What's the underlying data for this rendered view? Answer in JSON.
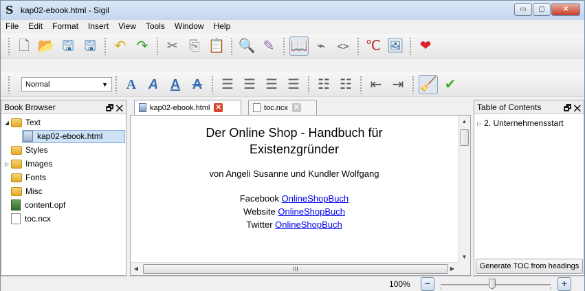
{
  "window": {
    "app_icon": "S",
    "title": "kap02-ebook.html - Sigil",
    "controls": {
      "minimize": "▭",
      "maximize": "▢",
      "close": "✕"
    }
  },
  "menu": [
    "File",
    "Edit",
    "Format",
    "Insert",
    "View",
    "Tools",
    "Window",
    "Help"
  ],
  "toolbar1": [
    {
      "name": "new-file-icon",
      "glyph": "🗋",
      "color": "#6b6b6b"
    },
    {
      "name": "open-folder-icon",
      "glyph": "📂",
      "color": "#3e66a8"
    },
    {
      "name": "save-icon",
      "glyph": "🖫",
      "color": "#2f6fb0"
    },
    {
      "name": "save-all-icon",
      "glyph": "🖫",
      "color": "#2f6fb0"
    },
    {
      "name": "sep"
    },
    {
      "name": "undo-icon",
      "glyph": "↶",
      "color": "#d8a800"
    },
    {
      "name": "redo-icon",
      "glyph": "↷",
      "color": "#3b9a2e"
    },
    {
      "name": "sep"
    },
    {
      "name": "cut-icon",
      "glyph": "✂",
      "color": "#7a7a7a"
    },
    {
      "name": "copy-icon",
      "glyph": "⎘",
      "color": "#8a8a8a"
    },
    {
      "name": "paste-icon",
      "glyph": "📋",
      "color": "#7a5c3a"
    },
    {
      "name": "sep"
    },
    {
      "name": "find-replace-icon",
      "glyph": "🔍",
      "color": "#556677"
    },
    {
      "name": "meta-editor-icon",
      "glyph": "✎",
      "color": "#8a6fa8"
    },
    {
      "name": "sep"
    },
    {
      "name": "book-view-icon",
      "glyph": "📖",
      "color": "#333333",
      "active": true
    },
    {
      "name": "split-view-icon",
      "glyph": "⌁",
      "color": "#555555"
    },
    {
      "name": "code-view-icon",
      "glyph": "<>",
      "color": "#333333"
    },
    {
      "name": "sep"
    },
    {
      "name": "insert-special-char-icon",
      "glyph": "℃",
      "color": "#b5262a"
    },
    {
      "name": "insert-image-icon",
      "glyph": "🖼",
      "color": "#3a6fa8"
    },
    {
      "name": "sep"
    },
    {
      "name": "donate-heart-icon",
      "glyph": "❤",
      "color": "#d8222a"
    }
  ],
  "toolbar2": {
    "style_value": "Normal",
    "buttons": [
      {
        "name": "sep"
      },
      {
        "name": "bold-icon",
        "glyph": "A",
        "color": "#3a6fb0",
        "style": "bold"
      },
      {
        "name": "italic-icon",
        "glyph": "A",
        "color": "#3a6fb0",
        "style": "italic"
      },
      {
        "name": "underline-icon",
        "glyph": "A",
        "color": "#3a6fb0",
        "style": "underline"
      },
      {
        "name": "strikethrough-icon",
        "glyph": "A",
        "color": "#3a6fb0",
        "style": "strike"
      },
      {
        "name": "sep"
      },
      {
        "name": "align-left-icon",
        "glyph": "☰",
        "color": "#666666"
      },
      {
        "name": "align-center-icon",
        "glyph": "☰",
        "color": "#666666"
      },
      {
        "name": "align-right-icon",
        "glyph": "☰",
        "color": "#666666"
      },
      {
        "name": "align-justify-icon",
        "glyph": "☰",
        "color": "#666666"
      },
      {
        "name": "sep"
      },
      {
        "name": "bullet-list-icon",
        "glyph": "☷",
        "color": "#555555"
      },
      {
        "name": "numbered-list-icon",
        "glyph": "☷",
        "color": "#555555"
      },
      {
        "name": "sep"
      },
      {
        "name": "decrease-indent-icon",
        "glyph": "⇤",
        "color": "#555555"
      },
      {
        "name": "increase-indent-icon",
        "glyph": "⇥",
        "color": "#555555"
      },
      {
        "name": "sep"
      },
      {
        "name": "clean-source-broom-icon",
        "glyph": "🧹",
        "color": "#d9a21b",
        "active": true
      },
      {
        "name": "validate-checkmark-icon",
        "glyph": "✔",
        "color": "#3fae2a"
      }
    ]
  },
  "book_browser": {
    "title": "Book Browser",
    "controls": "🗗 ✕",
    "items": [
      {
        "label": "Text",
        "type": "folder",
        "expander": "◢",
        "indent": 0
      },
      {
        "label": "kap02-ebook.html",
        "type": "html",
        "indent": 1,
        "selected": true
      },
      {
        "label": "Styles",
        "type": "folder",
        "indent": 0
      },
      {
        "label": "Images",
        "type": "folder",
        "expander": "▷",
        "indent": 0
      },
      {
        "label": "Fonts",
        "type": "folder",
        "indent": 0
      },
      {
        "label": "Misc",
        "type": "folder",
        "indent": 0
      },
      {
        "label": "content.opf",
        "type": "opf",
        "indent": 0
      },
      {
        "label": "toc.ncx",
        "type": "file",
        "indent": 0
      }
    ]
  },
  "tabs": [
    {
      "label": "kap02-ebook.html",
      "active": true
    },
    {
      "label": "toc.ncx",
      "active": false
    }
  ],
  "document": {
    "title_line1": "Der Online Shop - Handbuch für",
    "title_line2": "Existenzgründer",
    "author": "von Angeli Susanne und Kundler Wolfgang",
    "links": [
      {
        "prefix": "Facebook",
        "link": "OnlineShopBuch"
      },
      {
        "prefix": "Website",
        "link": "OnlineShopBuch"
      },
      {
        "prefix": "Twitter",
        "link": "OnlineShopBuch"
      }
    ],
    "hscroll_grip": "III"
  },
  "toc_panel": {
    "title": "Table of Contents",
    "controls": "🗗 ✕",
    "items": [
      {
        "label": "2. Unternehmensstart",
        "expander": "▷"
      }
    ],
    "generate_button": "Generate TOC from headings"
  },
  "statusbar": {
    "zoom": "100%",
    "zoom_value_percent": 100,
    "minus": "−",
    "plus": "+"
  }
}
